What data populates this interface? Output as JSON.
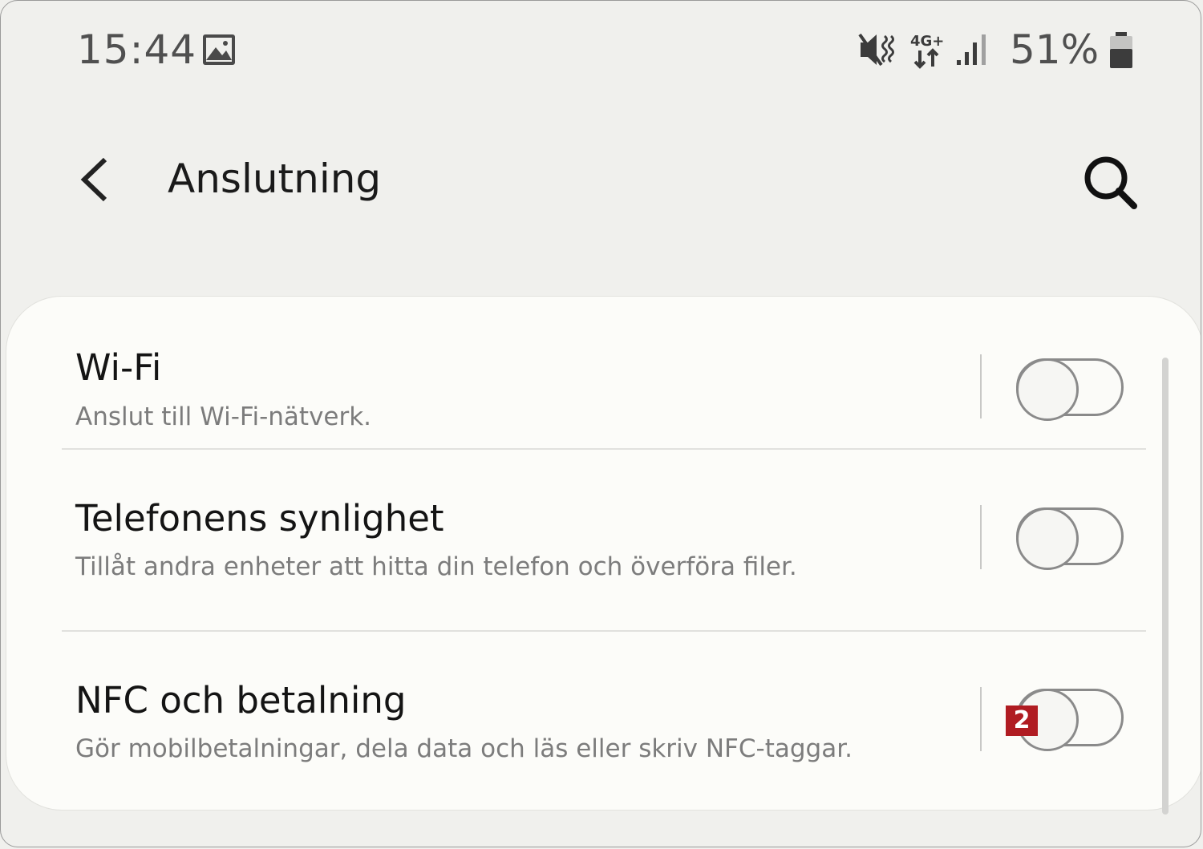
{
  "status_bar": {
    "time": "15:44",
    "network_type": "4G+",
    "battery_percent": "51%",
    "icons": [
      "gallery-icon",
      "mute-vibrate-icon",
      "4g-plus-data-icon",
      "signal-strength-icon",
      "battery-icon"
    ]
  },
  "header": {
    "title": "Anslutning",
    "back_icon": "chevron-left-icon",
    "search_icon": "search-icon"
  },
  "settings": [
    {
      "title": "Wi-Fi",
      "subtitle": "Anslut till Wi-Fi-nätverk.",
      "enabled": false
    },
    {
      "title": "Telefonens synlighet",
      "subtitle": "Tillåt andra enheter att hitta din telefon och överföra filer.",
      "enabled": false
    },
    {
      "title": "NFC och betalning",
      "subtitle": "Gör mobilbetalningar, dela data och läs eller skriv NFC-taggar.",
      "enabled": false
    }
  ],
  "annotation": {
    "label": "2",
    "color": "#b01c22"
  },
  "colors": {
    "background": "#f0f0ed",
    "card": "#fcfcf9",
    "toggle_off": "#8a8a8a"
  }
}
